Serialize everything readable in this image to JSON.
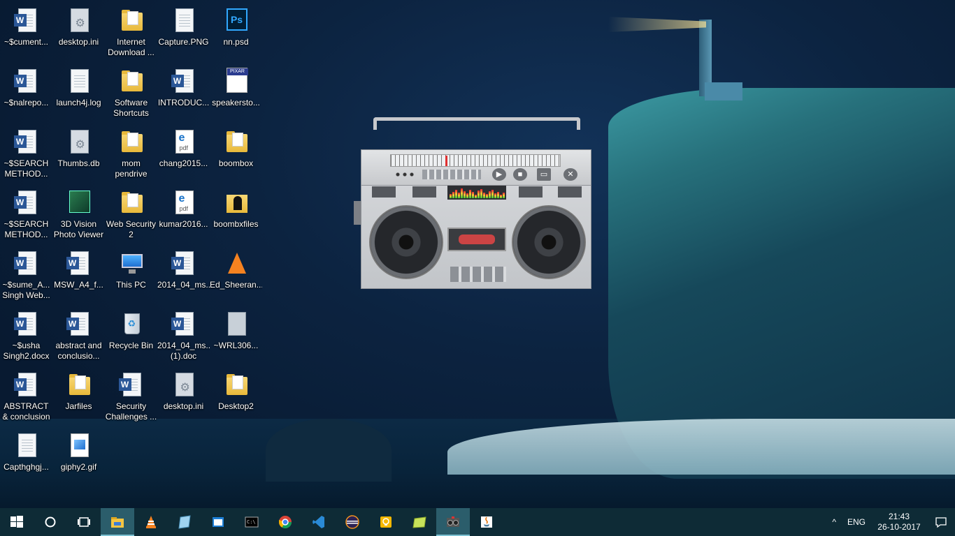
{
  "desktop": {
    "icons": [
      {
        "label": "~$cument...",
        "type": "word"
      },
      {
        "label": "desktop.ini",
        "type": "gear"
      },
      {
        "label": "Internet Download ...",
        "type": "folder"
      },
      {
        "label": "Capture.PNG",
        "type": "image-doc"
      },
      {
        "label": "nn.psd",
        "type": "psd"
      },
      {
        "label": "~$nalrepo...",
        "type": "word"
      },
      {
        "label": "launch4j.log",
        "type": "text"
      },
      {
        "label": "Software Shortcuts",
        "type": "folder"
      },
      {
        "label": "INTRODUC...",
        "type": "word"
      },
      {
        "label": "speakersto...",
        "type": "pixar"
      },
      {
        "label": "~$SEARCH METHOD...",
        "type": "word"
      },
      {
        "label": "Thumbs.db",
        "type": "gear"
      },
      {
        "label": "mom pendrive",
        "type": "folder"
      },
      {
        "label": "chang2015...",
        "type": "pdf"
      },
      {
        "label": "boombox",
        "type": "folder"
      },
      {
        "label": "~$SEARCH METHOD...",
        "type": "word"
      },
      {
        "label": "3D Vision Photo Viewer",
        "type": "3d"
      },
      {
        "label": "Web Security 2",
        "type": "folder"
      },
      {
        "label": "kumar2016...",
        "type": "pdf"
      },
      {
        "label": "boombxfiles",
        "type": "dark-folder"
      },
      {
        "label": "~$sume_A... Singh Web...",
        "type": "word"
      },
      {
        "label": "MSW_A4_f...",
        "type": "word"
      },
      {
        "label": "This PC",
        "type": "pc"
      },
      {
        "label": "2014_04_ms...",
        "type": "word"
      },
      {
        "label": "Ed_Sheeran...",
        "type": "vlc"
      },
      {
        "label": "~$usha Singh2.docx",
        "type": "word"
      },
      {
        "label": "abstract and conclusio...",
        "type": "word"
      },
      {
        "label": "Recycle Bin",
        "type": "bin"
      },
      {
        "label": "2014_04_ms... (1).doc",
        "type": "word"
      },
      {
        "label": "~WRL306...",
        "type": "blank"
      },
      {
        "label": "ABSTRACT & conclusion ...",
        "type": "word"
      },
      {
        "label": "Jarfiles",
        "type": "folder"
      },
      {
        "label": "Security Challenges ...",
        "type": "word"
      },
      {
        "label": "desktop.ini",
        "type": "gear"
      },
      {
        "label": "Desktop2",
        "type": "folder"
      },
      {
        "label": "Capthghgj...",
        "type": "image-doc"
      },
      {
        "label": "giphy2.gif",
        "type": "gif"
      }
    ]
  },
  "boombox": {
    "buttons": [
      {
        "name": "play-button",
        "glyph": "▶"
      },
      {
        "name": "stop-button",
        "glyph": "■"
      },
      {
        "name": "open-folder-button",
        "glyph": "▭"
      },
      {
        "name": "close-button",
        "glyph": "✕"
      }
    ]
  },
  "taskbar": {
    "items": [
      {
        "name": "start-button",
        "icon": "windows-logo-icon"
      },
      {
        "name": "search-button",
        "icon": "cortana-circle-icon"
      },
      {
        "name": "task-view-button",
        "icon": "task-view-icon"
      },
      {
        "name": "file-explorer-button",
        "icon": "folder-icon",
        "active": true
      },
      {
        "name": "vlc-button",
        "icon": "vlc-cone-icon"
      },
      {
        "name": "notes-button",
        "icon": "notepad-icon"
      },
      {
        "name": "media-button",
        "icon": "window-icon"
      },
      {
        "name": "cmd-button",
        "icon": "terminal-icon"
      },
      {
        "name": "chrome-button",
        "icon": "chrome-icon"
      },
      {
        "name": "vscode-button",
        "icon": "vscode-icon"
      },
      {
        "name": "eclipse-button",
        "icon": "eclipse-icon"
      },
      {
        "name": "tips-button",
        "icon": "lightbulb-icon"
      },
      {
        "name": "sticky-button",
        "icon": "sticky-note-icon"
      },
      {
        "name": "boombox-app-button",
        "icon": "boombox-app-icon",
        "active": true
      },
      {
        "name": "java-button",
        "icon": "java-icon"
      }
    ],
    "tray": {
      "chevron": "^",
      "language": "ENG",
      "time": "21:43",
      "date": "26-10-2017"
    }
  },
  "colors": {
    "taskbar_bg": "#0e2b36",
    "active_item": "#2b5d6b",
    "desktop_text": "#ffffff"
  }
}
